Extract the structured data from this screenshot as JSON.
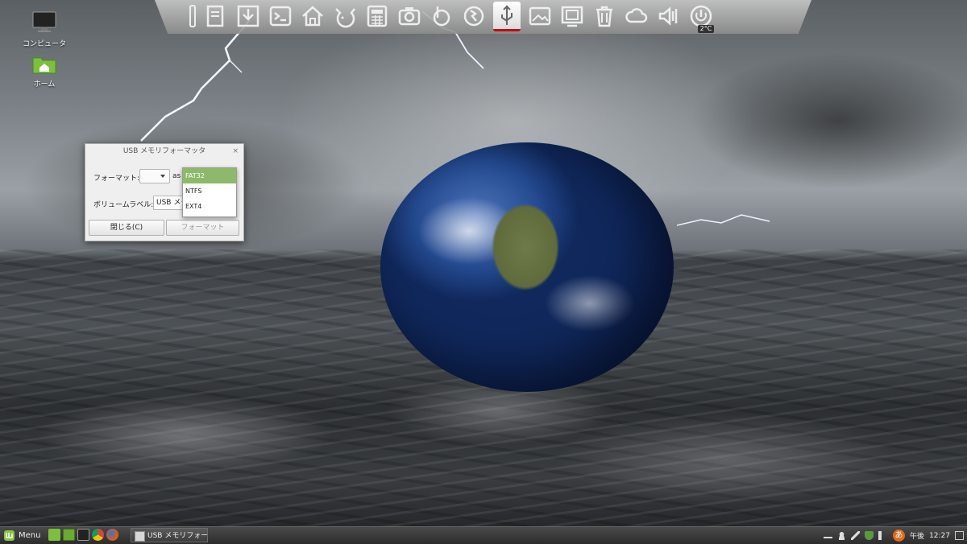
{
  "desktop": {
    "icons": [
      {
        "label": "コンピュータ",
        "icon": "monitor-icon"
      },
      {
        "label": "ホーム",
        "icon": "home-folder-icon"
      }
    ]
  },
  "dock": {
    "weather_temp": "2°C",
    "icons": [
      "usb-stick-icon",
      "document-icon",
      "download-icon",
      "terminal-icon",
      "home-icon",
      "pidgin-icon",
      "calculator-icon",
      "camera-icon",
      "backup-icon",
      "update-icon",
      "usb-format-icon",
      "image-icon",
      "window-icon",
      "trash-icon",
      "weather-icon",
      "volume-icon",
      "power-icon"
    ]
  },
  "dialog": {
    "title": "USB メモリフォーマッタ",
    "format_label": "フォーマット:",
    "as_text": "as",
    "format_selected": "",
    "volume_label": "ボリュームラベル:",
    "volume_value": "USB メモリ",
    "close_button": "閉じる(C)",
    "format_button": "フォーマット",
    "close_icon": "close-icon"
  },
  "format_menu": {
    "options": [
      "FAT32",
      "NTFS",
      "EXT4"
    ],
    "selected": "FAT32"
  },
  "taskbar": {
    "menu_label": "Menu",
    "window_title": "USB メモリフォー...",
    "clock_ampm": "午後",
    "clock_time": "12:27",
    "ime_label": "あ"
  }
}
